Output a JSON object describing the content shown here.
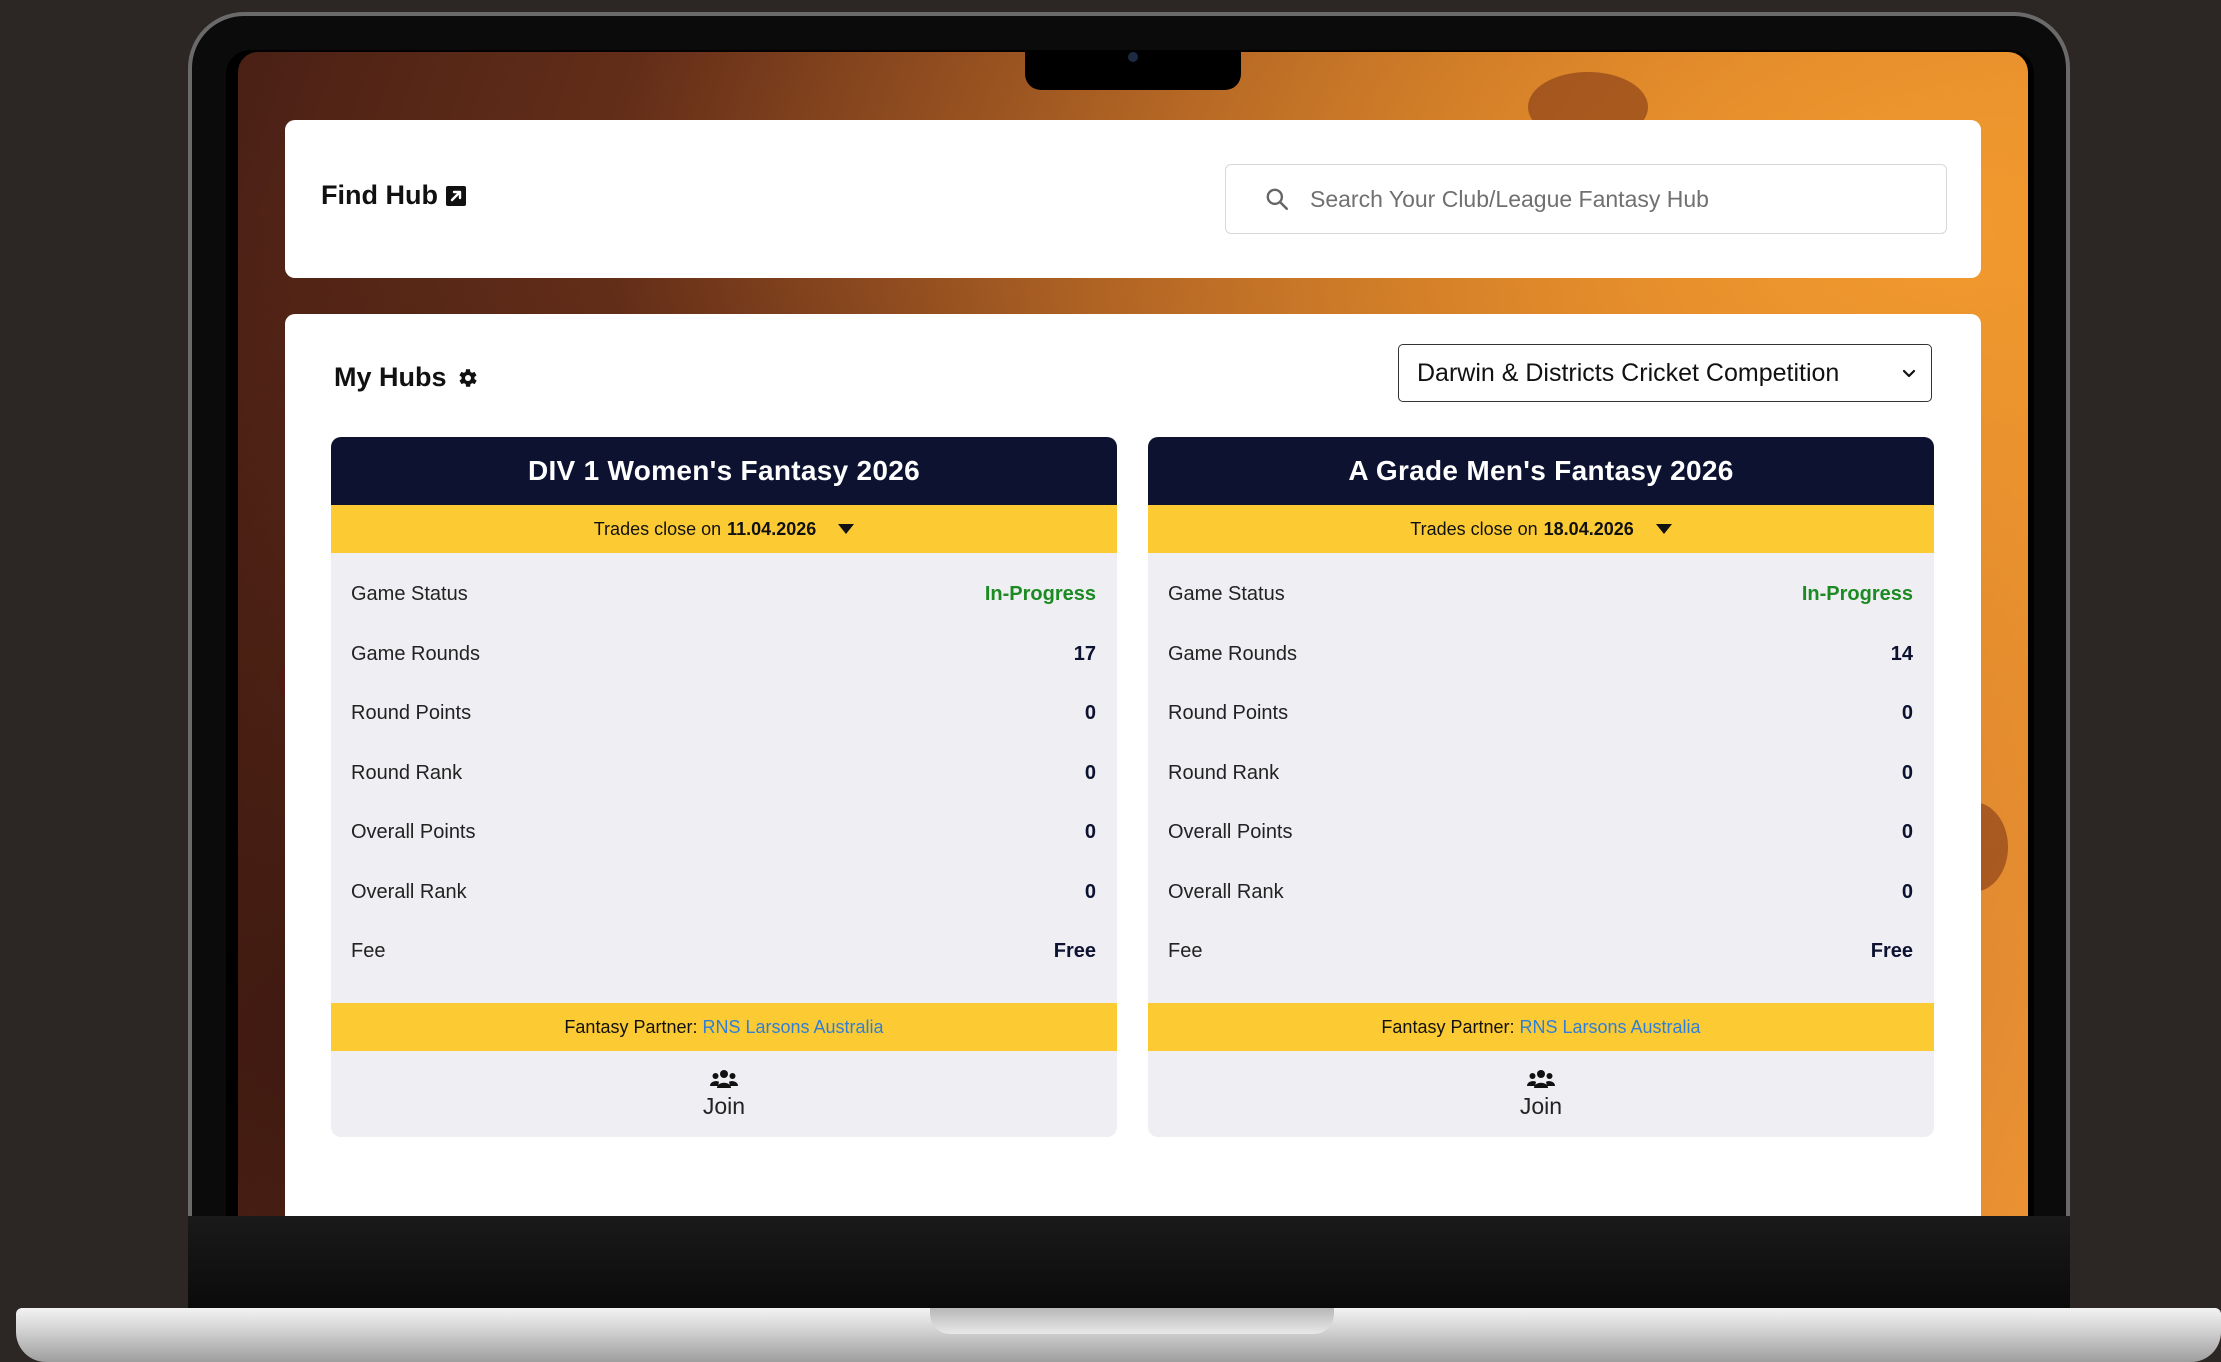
{
  "find_hub": {
    "title": "Find Hub",
    "search_placeholder": "Search Your Club/League Fantasy Hub"
  },
  "my_hubs": {
    "title": "My Hubs",
    "competition_selected": "Darwin & Districts Cricket Competition"
  },
  "hubs": [
    {
      "title": "DIV 1 Women's Fantasy 2026",
      "trades_prefix": "Trades close on",
      "trades_date": "11.04.2026",
      "rows": [
        {
          "label": "Game Status",
          "value": "In-Progress"
        },
        {
          "label": "Game Rounds",
          "value": "17"
        },
        {
          "label": "Round Points",
          "value": "0"
        },
        {
          "label": "Round Rank",
          "value": "0"
        },
        {
          "label": "Overall Points",
          "value": "0"
        },
        {
          "label": "Overall Rank",
          "value": "0"
        },
        {
          "label": "Fee",
          "value": "Free"
        }
      ],
      "partner_label": "Fantasy Partner:",
      "partner_name": "RNS Larsons Australia",
      "join_label": "Join"
    },
    {
      "title": "A Grade Men's Fantasy 2026",
      "trades_prefix": "Trades close on",
      "trades_date": "18.04.2026",
      "rows": [
        {
          "label": "Game Status",
          "value": "In-Progress"
        },
        {
          "label": "Game Rounds",
          "value": "14"
        },
        {
          "label": "Round Points",
          "value": "0"
        },
        {
          "label": "Round Rank",
          "value": "0"
        },
        {
          "label": "Overall Points",
          "value": "0"
        },
        {
          "label": "Overall Rank",
          "value": "0"
        },
        {
          "label": "Fee",
          "value": "Free"
        }
      ],
      "partner_label": "Fantasy Partner:",
      "partner_name": "RNS Larsons Australia",
      "join_label": "Join"
    }
  ],
  "colors": {
    "header_navy": "#0c1230",
    "accent_yellow": "#fccb33",
    "status_green": "#1b8a22",
    "link_blue": "#2f7fd8"
  }
}
